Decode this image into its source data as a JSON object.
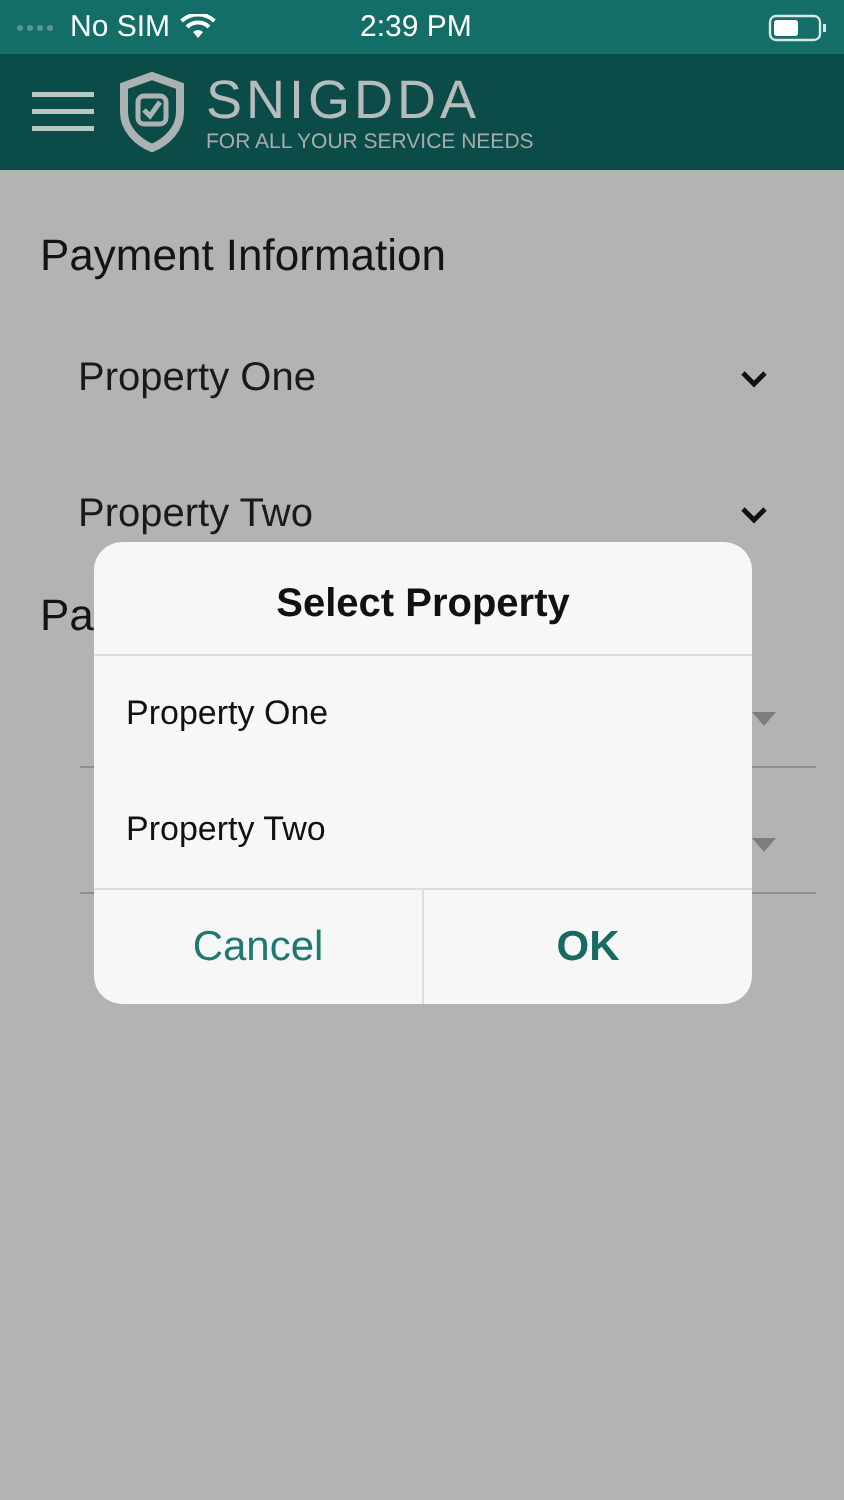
{
  "status_bar": {
    "carrier": "No SIM",
    "time": "2:39 PM"
  },
  "header": {
    "logo_name": "SNIGDDA",
    "tagline": "FOR ALL YOUR SERVICE NEEDS"
  },
  "payment_information": {
    "title": "Payment Information",
    "properties": [
      {
        "label": "Property One"
      },
      {
        "label": "Property Two"
      }
    ]
  },
  "section_2": {
    "title": "Pa",
    "fields": [
      {
        "kind": "select"
      },
      {
        "kind": "select"
      }
    ]
  },
  "dialog": {
    "title": "Select Property",
    "options": [
      {
        "label": "Property One"
      },
      {
        "label": "Property Two"
      }
    ],
    "buttons": [
      {
        "label": "Cancel",
        "kind": "cancel"
      },
      {
        "label": "OK",
        "kind": "confirm"
      }
    ]
  }
}
